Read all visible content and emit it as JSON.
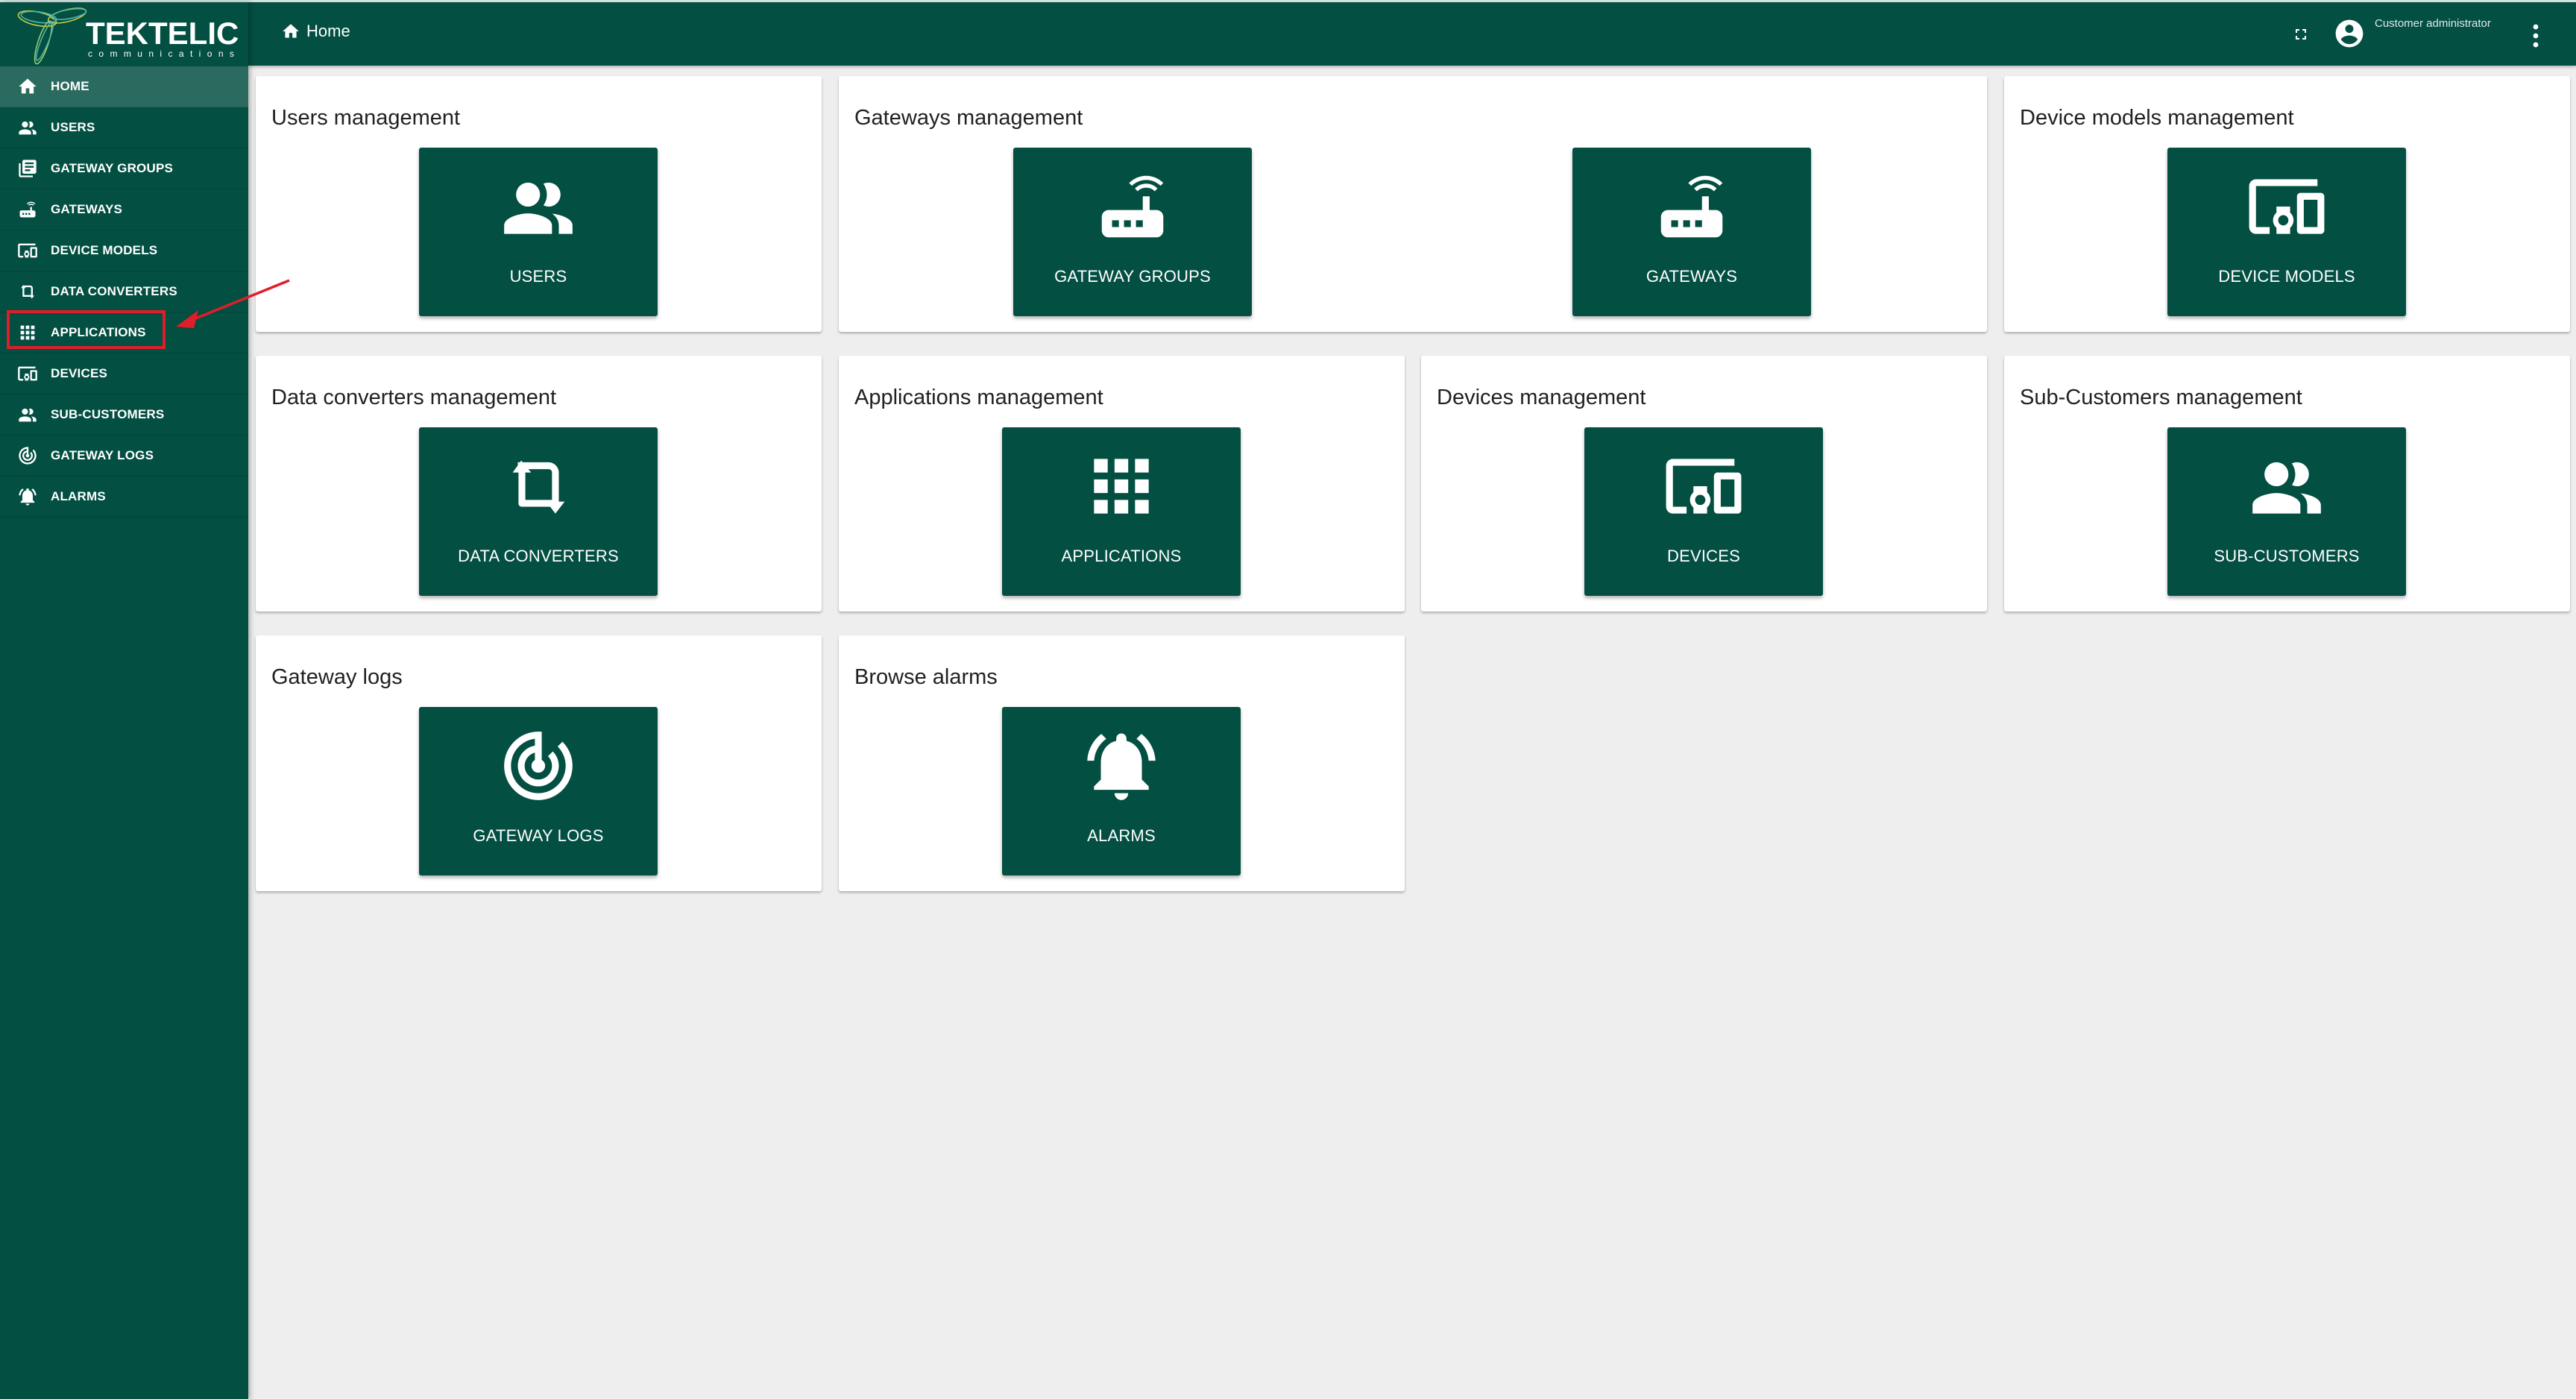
{
  "app": {
    "brand": "TEKTELIC",
    "brand_sub": "communications"
  },
  "sidebar": {
    "items": [
      {
        "label": "HOME",
        "icon": "home-icon",
        "active": true
      },
      {
        "label": "USERS",
        "icon": "users-icon"
      },
      {
        "label": "GATEWAY GROUPS",
        "icon": "gateway-groups-icon"
      },
      {
        "label": "GATEWAYS",
        "icon": "gateway-icon"
      },
      {
        "label": "DEVICE MODELS",
        "icon": "devices-icon"
      },
      {
        "label": "DATA CONVERTERS",
        "icon": "crop-rotate-icon"
      },
      {
        "label": "APPLICATIONS",
        "icon": "apps-grid-icon",
        "highlighted": true
      },
      {
        "label": "DEVICES",
        "icon": "devices-icon"
      },
      {
        "label": "SUB-CUSTOMERS",
        "icon": "users-icon"
      },
      {
        "label": "GATEWAY LOGS",
        "icon": "track-changes-icon"
      },
      {
        "label": "ALARMS",
        "icon": "alarm-bell-icon"
      }
    ]
  },
  "topbar": {
    "breadcrumb": "Home",
    "user_role": "Customer administrator"
  },
  "annotation": {
    "highlight_color": "#e21d2a",
    "target": "APPLICATIONS"
  },
  "colors": {
    "primary": "#034f42",
    "active_item": "#2b6a5e",
    "background": "#eeeeee"
  },
  "cards": [
    {
      "title": "Users management",
      "tiles": [
        {
          "label": "USERS",
          "icon": "users-icon"
        }
      ]
    },
    {
      "title": "Gateways management",
      "tiles": [
        {
          "label": "GATEWAY GROUPS",
          "icon": "gateway-icon"
        },
        {
          "label": "GATEWAYS",
          "icon": "gateway-icon"
        }
      ]
    },
    {
      "title": "Device models management",
      "tiles": [
        {
          "label": "DEVICE MODELS",
          "icon": "devices-icon"
        }
      ]
    },
    {
      "title": "Data converters management",
      "tiles": [
        {
          "label": "DATA CONVERTERS",
          "icon": "crop-rotate-icon"
        }
      ]
    },
    {
      "title": "Applications management",
      "tiles": [
        {
          "label": "APPLICATIONS",
          "icon": "apps-grid-icon"
        }
      ]
    },
    {
      "title": "Devices management",
      "tiles": [
        {
          "label": "DEVICES",
          "icon": "devices-icon"
        }
      ]
    },
    {
      "title": "Sub-Customers management",
      "tiles": [
        {
          "label": "SUB-CUSTOMERS",
          "icon": "users-icon"
        }
      ]
    },
    {
      "title": "Gateway logs",
      "tiles": [
        {
          "label": "GATEWAY LOGS",
          "icon": "track-changes-icon"
        }
      ]
    },
    {
      "title": "Browse alarms",
      "tiles": [
        {
          "label": "ALARMS",
          "icon": "alarm-bell-icon"
        }
      ]
    }
  ]
}
